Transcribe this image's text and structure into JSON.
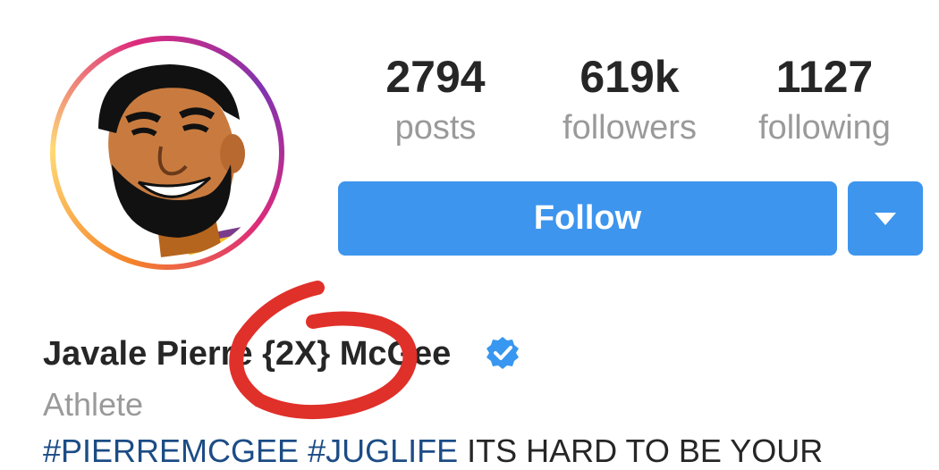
{
  "stats": {
    "posts": {
      "value": "2794",
      "label": "posts"
    },
    "followers": {
      "value": "619k",
      "label": "followers"
    },
    "following": {
      "value": "1127",
      "label": "following"
    }
  },
  "actions": {
    "follow_label": "Follow",
    "dropdown_icon": "caret-down-icon"
  },
  "profile": {
    "name": "Javale Pierre {2X} McGee",
    "verified": true,
    "category": "Athlete",
    "bio_tag1": "#PIERREMCGEE",
    "bio_tag2": "#JUGLIFE",
    "bio_text": "ITS HARD TO BE YOUR"
  },
  "colors": {
    "primary_button": "#3d95ed",
    "verified_badge": "#3897f0",
    "annotation_circle": "#e0302a"
  }
}
